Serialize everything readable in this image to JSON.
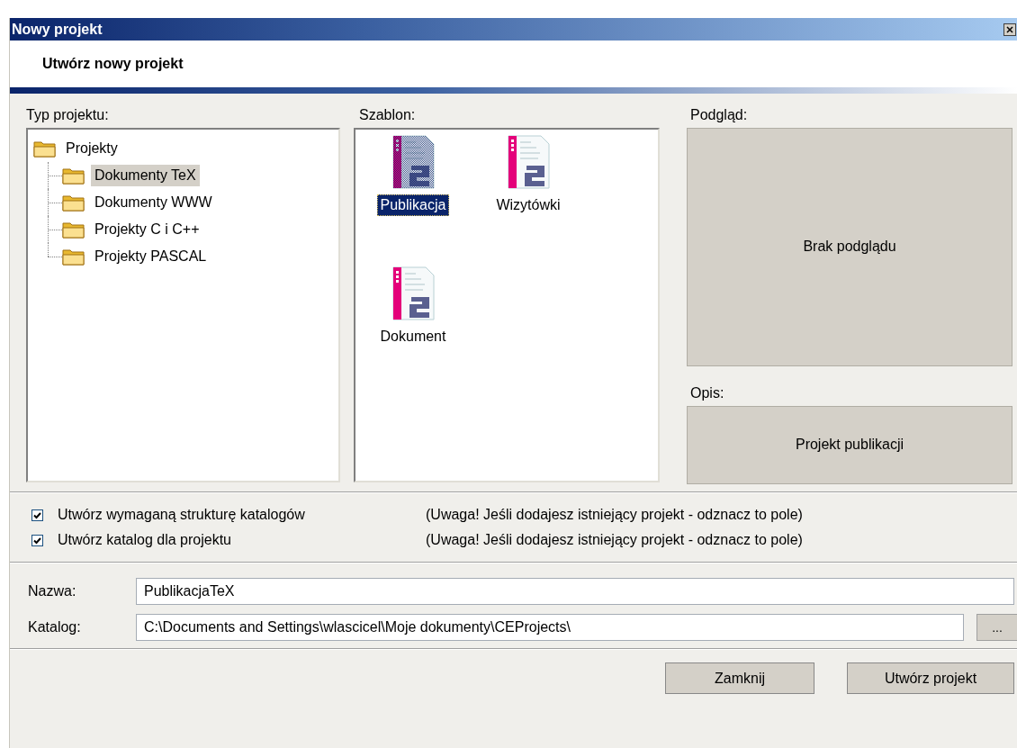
{
  "window": {
    "title": "Nowy projekt"
  },
  "header": {
    "title": "Utwórz nowy projekt"
  },
  "project_type": {
    "label": "Typ projektu:",
    "tree": {
      "label": "Projekty",
      "selected": false,
      "children": [
        {
          "label": "Dokumenty TeX",
          "selected": true
        },
        {
          "label": "Dokumenty WWW",
          "selected": false
        },
        {
          "label": "Projekty C i C++",
          "selected": false
        },
        {
          "label": "Projekty PASCAL",
          "selected": false
        }
      ]
    }
  },
  "template": {
    "label": "Szablon:",
    "items": [
      {
        "label": "Publikacja",
        "selected": true
      },
      {
        "label": "Wizytówki",
        "selected": false
      },
      {
        "label": "Dokument",
        "selected": false
      }
    ]
  },
  "preview": {
    "label": "Podgląd:",
    "text": "Brak podglądu"
  },
  "description": {
    "label": "Opis:",
    "text": "Projekt publikacji"
  },
  "options": [
    {
      "label": "Utwórz wymaganą strukturę katalogów",
      "checked": true,
      "note": "(Uwaga! Jeśli dodajesz istniejący projekt - odznacz to pole)"
    },
    {
      "label": "Utwórz katalog dla projektu",
      "checked": true,
      "note": "(Uwaga! Jeśli dodajesz istniejący projekt - odznacz to pole)"
    }
  ],
  "fields": [
    {
      "label": "Nazwa:",
      "value": "PublikacjaTeX"
    },
    {
      "label": "Katalog:",
      "value": "C:\\Documents and Settings\\wlascicel\\Moje dokumenty\\CEProjects\\",
      "browse_button": "..."
    }
  ],
  "buttons": [
    "Zamknij",
    "Utwórz projekt"
  ]
}
